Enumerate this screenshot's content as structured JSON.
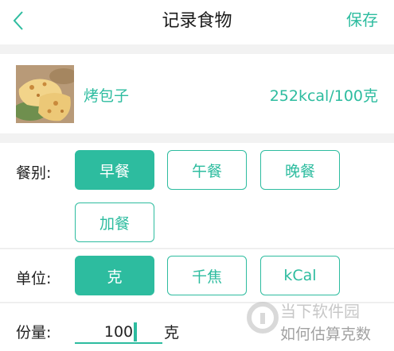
{
  "navbar": {
    "title": "记录食物",
    "save_label": "保存"
  },
  "food": {
    "name": "烤包子",
    "calories": "252kcal/100克"
  },
  "meal": {
    "label": "餐别:",
    "options": [
      "早餐",
      "午餐",
      "晚餐",
      "加餐"
    ],
    "selected": "早餐"
  },
  "unit": {
    "label": "单位:",
    "options": [
      "克",
      "千焦",
      "kCal"
    ],
    "selected": "克"
  },
  "amount": {
    "label": "份量:",
    "value": "100",
    "unit": "克"
  },
  "watermark": {
    "site": "当下软件园",
    "caption": "如何估算克数"
  },
  "colors": {
    "accent": "#2dbc9f",
    "divider": "#f2f2f2"
  }
}
